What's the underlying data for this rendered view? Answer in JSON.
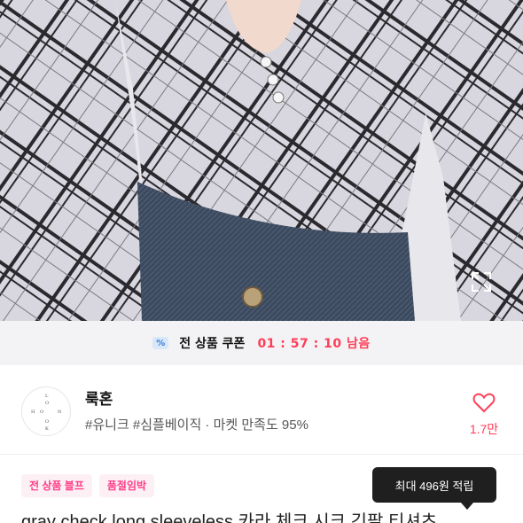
{
  "coupon": {
    "icon": "percent-coupon-icon",
    "label": "전 상품 쿠폰",
    "timer": "01 : 57 : 10 남음"
  },
  "shop": {
    "logo_letters": [
      "L",
      "O",
      "O",
      "K",
      "H",
      "O",
      "N"
    ],
    "name": "룩혼",
    "meta": "#유니크 #심플베이직 · 마켓 만족도 95%",
    "likes": "1.7만"
  },
  "tags": [
    {
      "label": "전 상품 블프"
    },
    {
      "label": "품절임박"
    }
  ],
  "tooltip": {
    "text": "최대 496원 적립"
  },
  "product": {
    "title": "gray check long sleeveless 카라 체크 시크 긴팔 티셔츠"
  },
  "colors": {
    "accent": "#ff3d57",
    "tag_bg": "#fdf0f5",
    "tag_text": "#ff3d87",
    "coupon_bar_bg": "#f3f3f5"
  }
}
